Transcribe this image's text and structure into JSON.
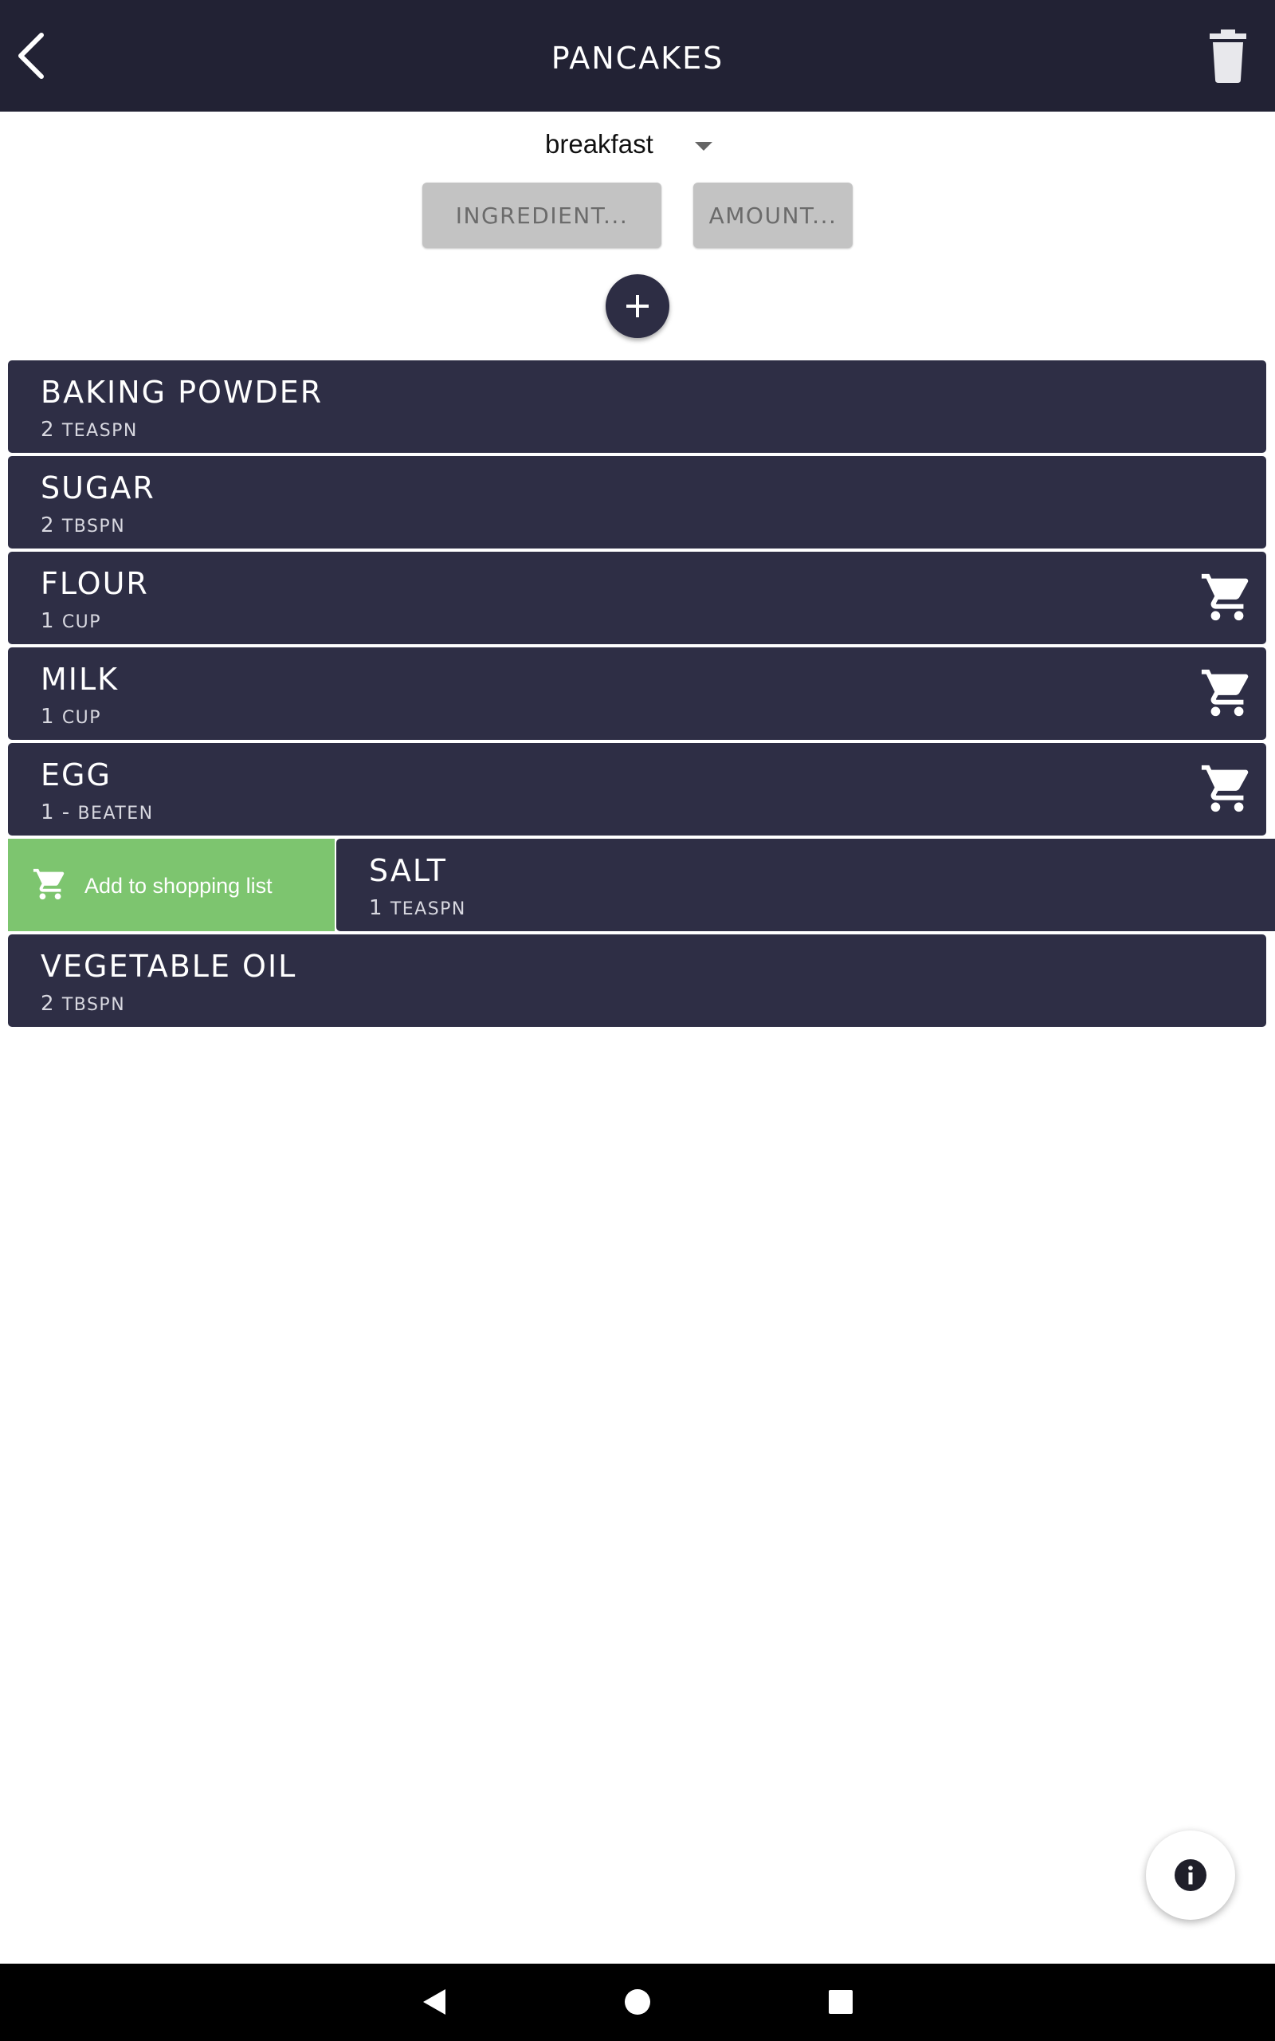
{
  "app": {
    "title": "PANCAKES",
    "icons": {
      "back": "chevron-left-icon",
      "delete": "trash-icon"
    }
  },
  "category": {
    "selected": "breakfast"
  },
  "inputs": {
    "ingredient_label": "INGREDIENT...",
    "amount_label": "AMOUNT..."
  },
  "add_button": {
    "icon": "plus-icon"
  },
  "ingredients": [
    {
      "name": "BAKING POWDER",
      "qty": "2",
      "unit": "TEASPN",
      "in_cart": false
    },
    {
      "name": "SUGAR",
      "qty": "2",
      "unit": "TBSPN",
      "in_cart": false
    },
    {
      "name": "FLOUR",
      "qty": "1",
      "unit": "CUP",
      "in_cart": true
    },
    {
      "name": "MILK",
      "qty": "1",
      "unit": "CUP",
      "in_cart": true
    },
    {
      "name": "EGG",
      "qty": "1 -",
      "unit": "BEATEN",
      "in_cart": true
    },
    {
      "name": "SALT",
      "qty": "1",
      "unit": "TEASPN",
      "in_cart": false
    },
    {
      "name": "VEGETABLE OIL",
      "qty": "2",
      "unit": "TBSPN",
      "in_cart": false
    }
  ],
  "swipe_action": {
    "label": "Add to shopping list",
    "color": "#7dc56f"
  },
  "colors": {
    "topbar": "#222234",
    "row": "#2e2e45",
    "accent_green": "#7dc56f"
  },
  "system_nav": {
    "icons": [
      "nav-back-icon",
      "nav-home-icon",
      "nav-recents-icon"
    ]
  }
}
